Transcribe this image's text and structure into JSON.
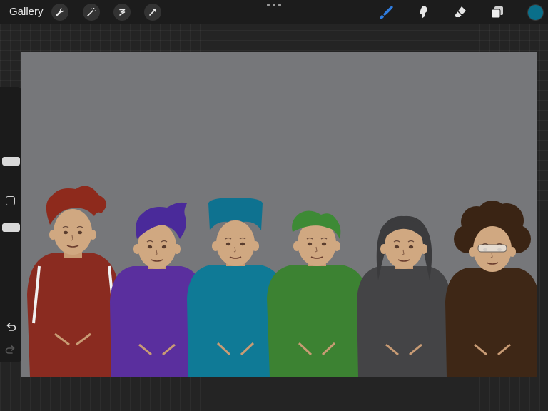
{
  "topbar": {
    "gallery_label": "Gallery",
    "left_tools": [
      "wrench-icon",
      "magic-wand-icon",
      "selection-icon",
      "transform-arrow-icon"
    ],
    "right_tools": [
      "brush-icon",
      "smudge-icon",
      "eraser-icon",
      "layers-icon"
    ],
    "active_tool": "brush-icon",
    "current_color": "#0a6f8a"
  },
  "sidebar": {
    "controls": [
      "brush-size-slider",
      "modify-button",
      "opacity-slider",
      "undo-icon",
      "redo-icon"
    ]
  },
  "canvas": {
    "background": "#76777a",
    "characters": [
      {
        "hair": "#8e2a1c",
        "hoodie": "#8a2b20"
      },
      {
        "hair": "#4a2a9a",
        "hoodie": "#5a2f9e"
      },
      {
        "hair": "#0e7290",
        "hoodie": "#0f7a96"
      },
      {
        "hair": "#3d8a35",
        "hoodie": "#3c8232"
      },
      {
        "hair": "#3b3b3d",
        "hoodie": "#444446"
      },
      {
        "hair": "#3a2414",
        "hoodie": "#3e2716"
      }
    ]
  }
}
